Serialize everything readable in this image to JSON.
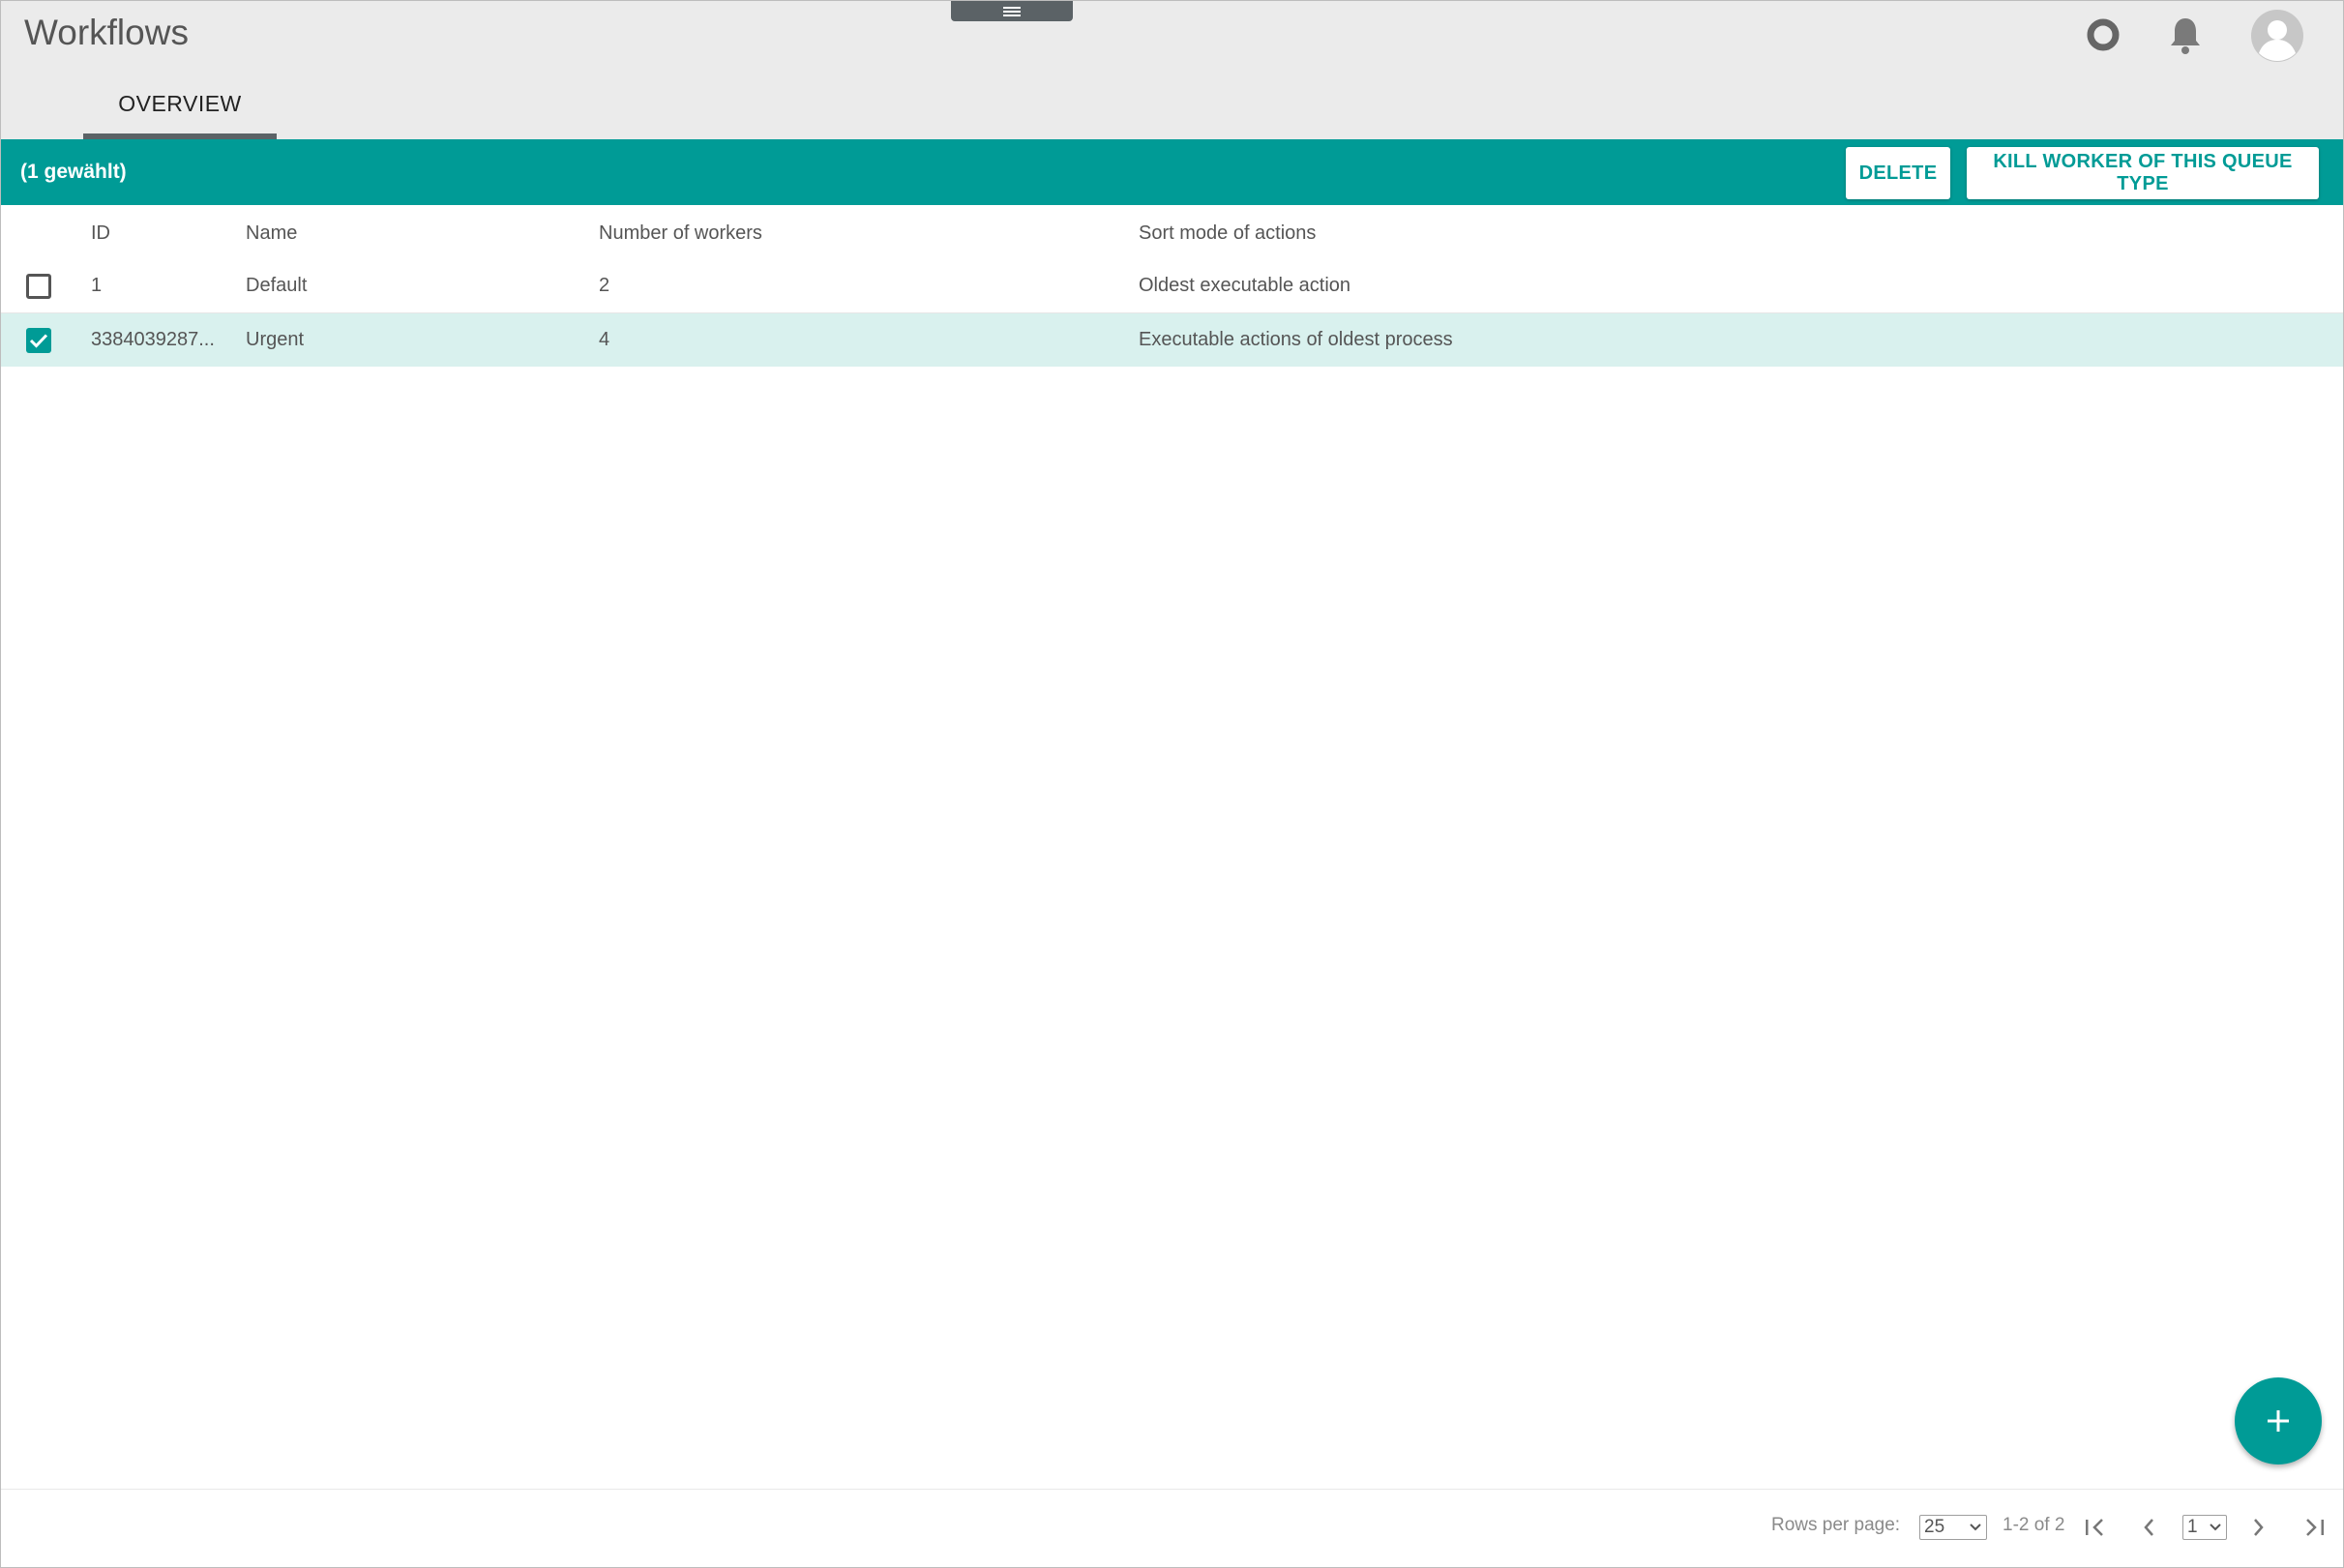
{
  "header": {
    "title": "Workflows",
    "icons": [
      "status-circle-icon",
      "bell-icon",
      "avatar-icon"
    ]
  },
  "tabs": [
    {
      "label": "OVERVIEW",
      "active": true
    }
  ],
  "action_bar": {
    "selected_text": "(1 gewählt)",
    "delete_label": "DELETE",
    "kill_label": "KILL WORKER OF THIS QUEUE TYPE"
  },
  "table": {
    "columns": [
      "ID",
      "Name",
      "Number of workers",
      "Sort mode of actions"
    ],
    "rows": [
      {
        "checked": false,
        "id": "1",
        "name": "Default",
        "workers": "2",
        "sort_mode": "Oldest executable action"
      },
      {
        "checked": true,
        "id": "3384039287...",
        "name": "Urgent",
        "workers": "4",
        "sort_mode": "Executable actions of oldest process"
      }
    ]
  },
  "pagination": {
    "rows_per_page_label": "Rows per page:",
    "rows_per_page_value": "25",
    "range_text": "1-2 of 2",
    "page_value": "1"
  },
  "colors": {
    "accent": "#009b96",
    "header_bg": "#ebebeb",
    "selected_row_bg": "#d9f1ee",
    "dark_gray": "#5b6266"
  }
}
